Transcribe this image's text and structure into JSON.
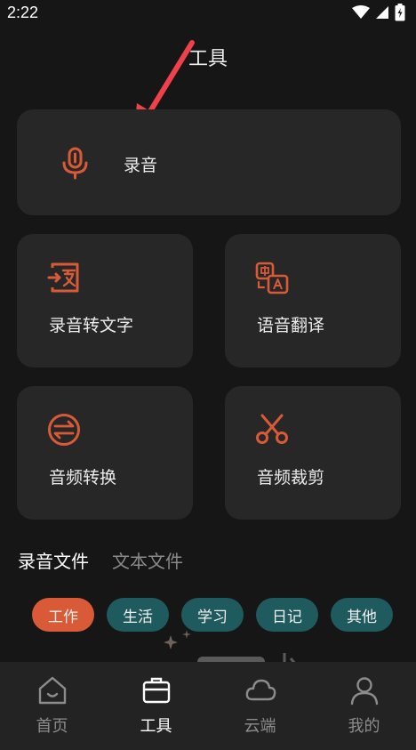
{
  "status": {
    "time": "2:22"
  },
  "header": {
    "title": "工具"
  },
  "tools": {
    "record": {
      "label": "录音",
      "icon": "microphone-icon"
    },
    "speech_to_text": {
      "label": "录音转文字",
      "icon": "transcribe-icon"
    },
    "voice_translate": {
      "label": "语音翻译",
      "icon": "translate-icon"
    },
    "audio_convert": {
      "label": "音频转换",
      "icon": "convert-icon"
    },
    "audio_trim": {
      "label": "音频裁剪",
      "icon": "scissors-icon"
    }
  },
  "file_tabs": [
    {
      "label": "录音文件",
      "active": true
    },
    {
      "label": "文本文件",
      "active": false
    }
  ],
  "categories": [
    {
      "label": "工作",
      "active": true
    },
    {
      "label": "生活",
      "active": false
    },
    {
      "label": "学习",
      "active": false
    },
    {
      "label": "日记",
      "active": false
    },
    {
      "label": "其他",
      "active": false
    }
  ],
  "bottom_nav": [
    {
      "label": "首页",
      "icon": "home-icon",
      "active": false
    },
    {
      "label": "工具",
      "icon": "toolbox-icon",
      "active": true
    },
    {
      "label": "云端",
      "icon": "cloud-icon",
      "active": false
    },
    {
      "label": "我的",
      "icon": "user-icon",
      "active": false
    }
  ],
  "colors": {
    "accent": "#D85A36",
    "chip_bg": "#1F5A5E",
    "card_bg": "#272727",
    "background": "#161616"
  }
}
